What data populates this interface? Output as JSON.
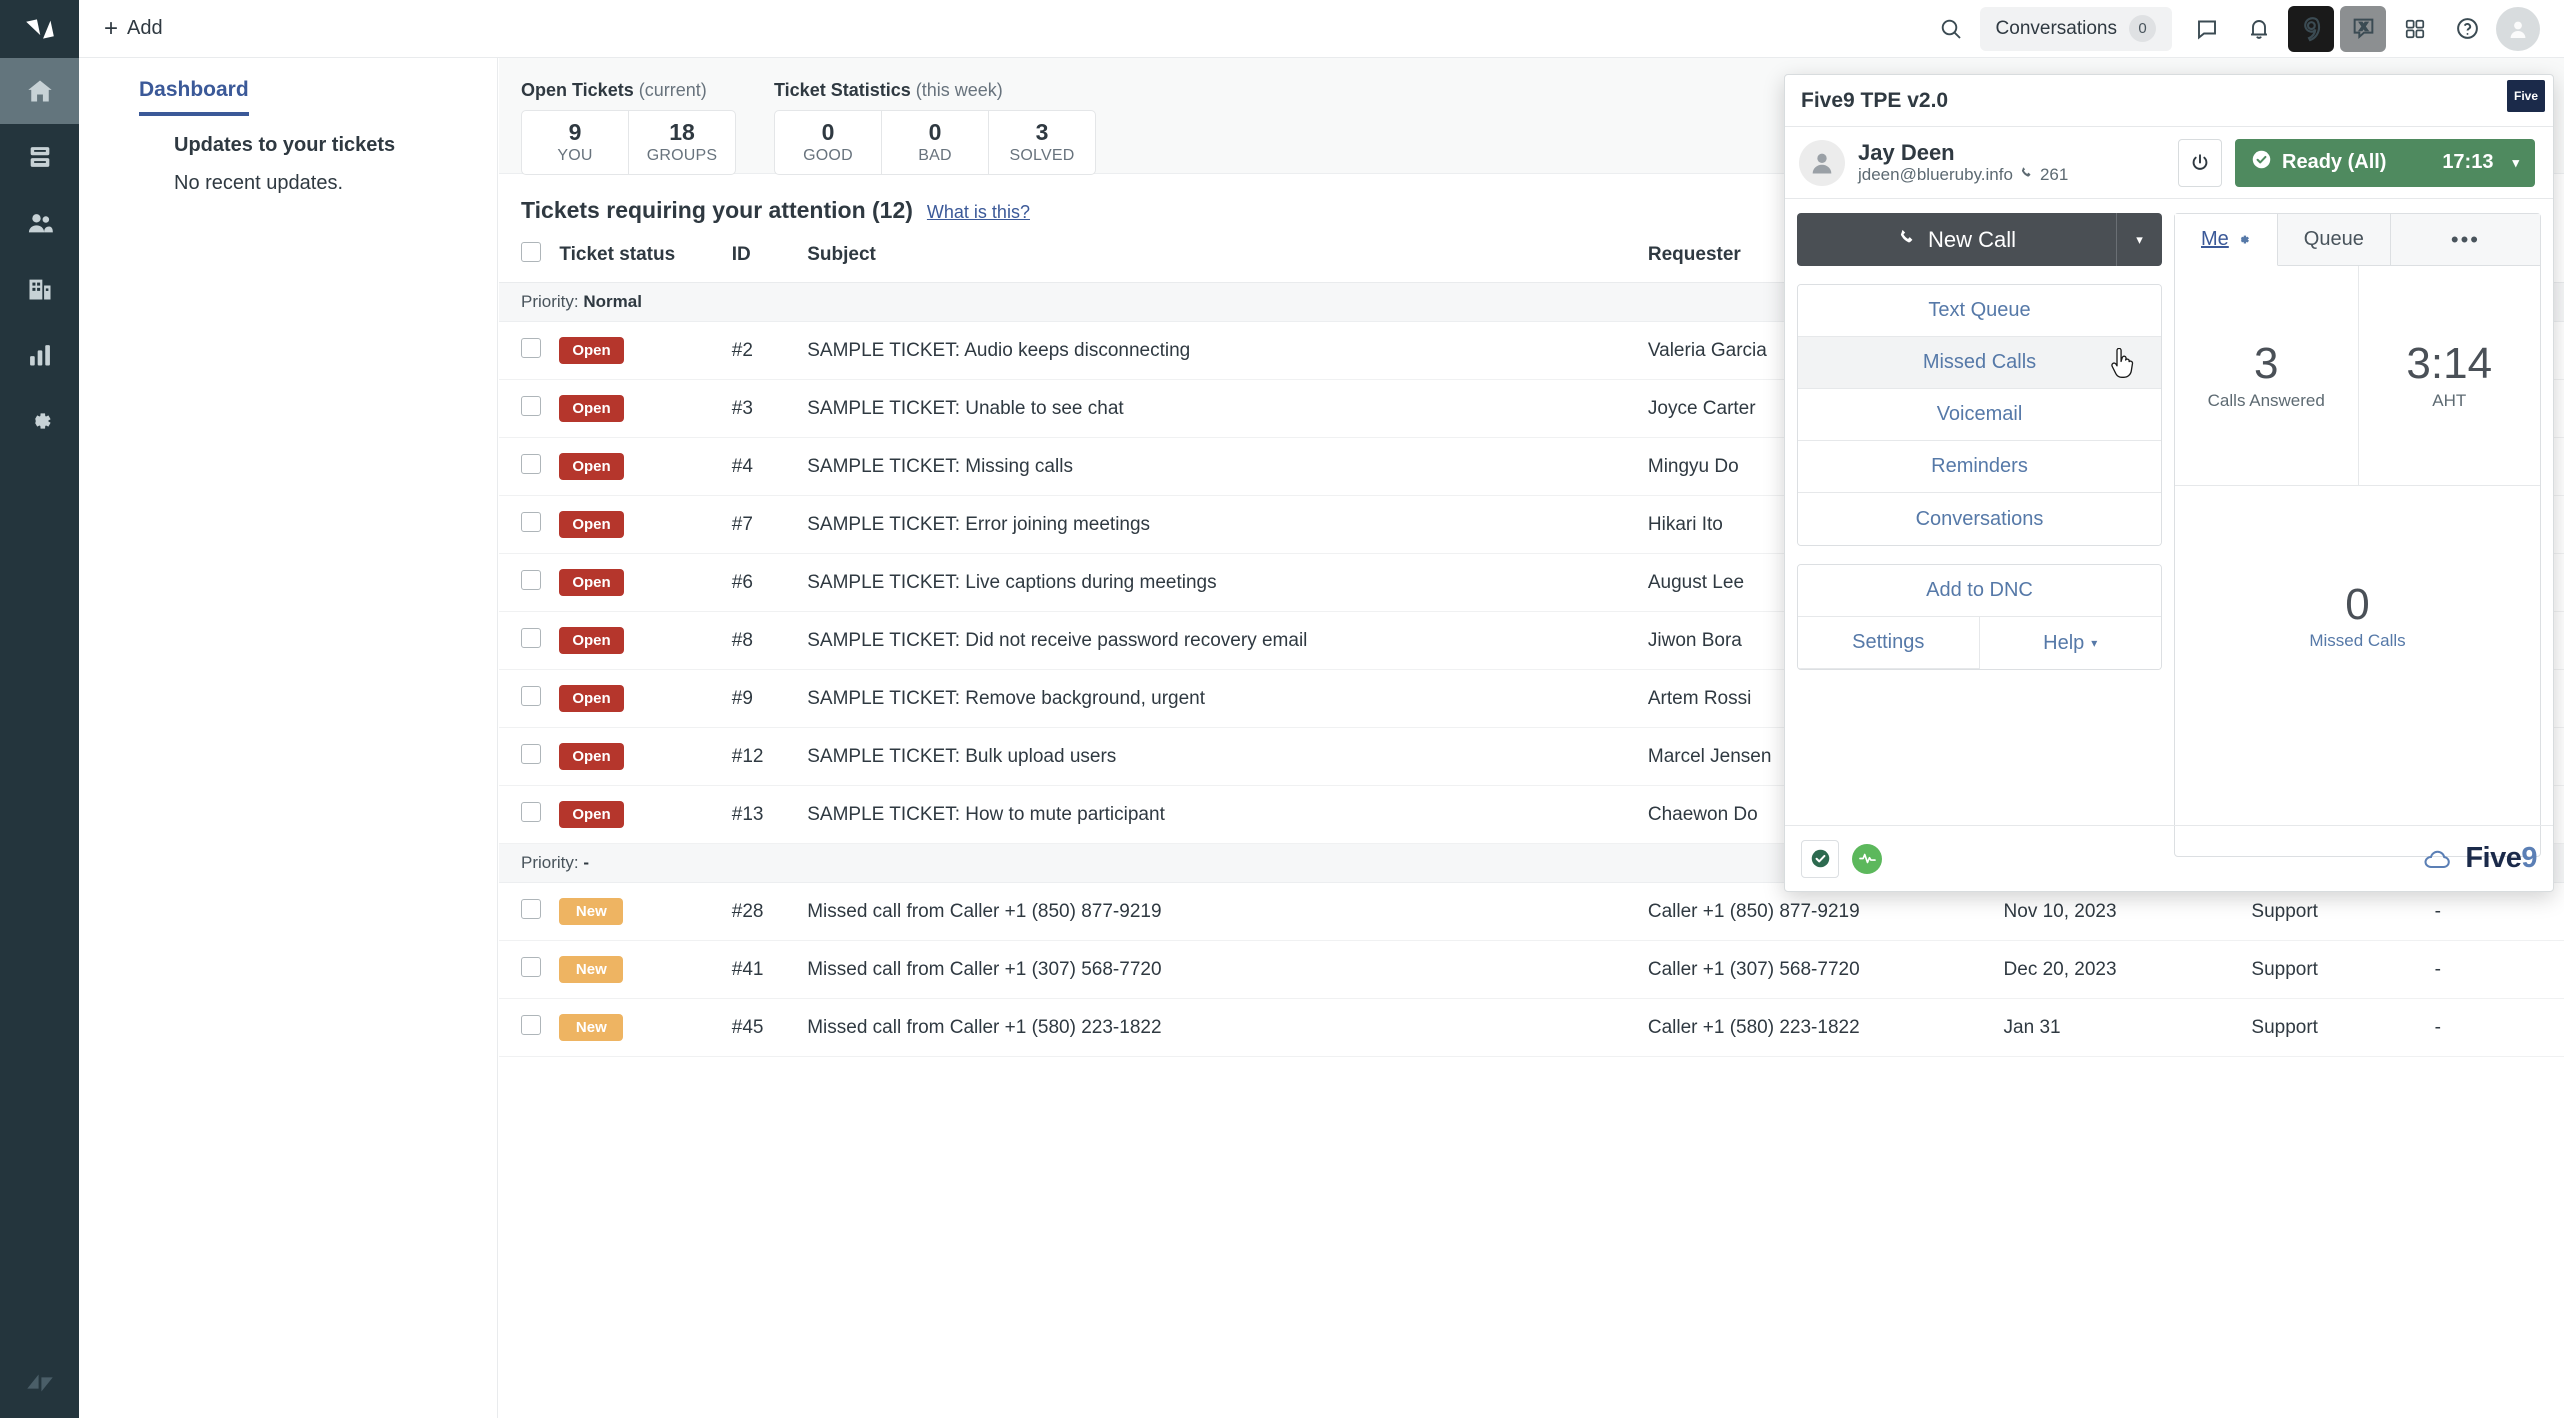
{
  "rail": {
    "items": [
      {
        "name": "zendesk-logo",
        "icon": "zendesk-logo-icon",
        "active": false
      },
      {
        "name": "home",
        "icon": "home-icon",
        "active": true
      },
      {
        "name": "views",
        "icon": "views-icon",
        "active": false
      },
      {
        "name": "customers",
        "icon": "people-icon",
        "active": false
      },
      {
        "name": "organizations",
        "icon": "building-icon",
        "active": false
      },
      {
        "name": "reporting",
        "icon": "bar-chart-icon",
        "active": false
      },
      {
        "name": "admin",
        "icon": "gear-icon",
        "active": false
      }
    ],
    "bottom_logo": "zendesk-mark-icon"
  },
  "topbar": {
    "add_label": "Add",
    "add_icon": "plus-icon",
    "search_icon": "search-icon",
    "conversations_label": "Conversations",
    "conversations_count": "0",
    "chat_icon": "chat-bubble-icon",
    "bell_icon": "bell-icon",
    "five9_icon_label": "9",
    "x_icon_label": "X",
    "apps_icon": "apps-grid-icon",
    "help_icon": "question-mark-icon",
    "avatar_icon": "user-avatar-icon"
  },
  "sidebar": {
    "tab_label": "Dashboard",
    "updates_title": "Updates to your tickets",
    "updates_empty": "No recent updates."
  },
  "stats": {
    "open_tickets": {
      "title_bold": "Open Tickets",
      "title_light": "(current)",
      "boxes": [
        {
          "num": "9",
          "label": "YOU"
        },
        {
          "num": "18",
          "label": "GROUPS"
        }
      ]
    },
    "ticket_statistics": {
      "title_bold": "Ticket Statistics",
      "title_light": "(this week)",
      "boxes": [
        {
          "num": "0",
          "label": "GOOD"
        },
        {
          "num": "0",
          "label": "BAD"
        },
        {
          "num": "3",
          "label": "SOLVED"
        }
      ]
    }
  },
  "attention": {
    "title": "Tickets requiring your attention (12)",
    "help_link": "What is this?"
  },
  "table": {
    "headers": {
      "status": "Ticket status",
      "id": "ID",
      "subject": "Subject",
      "requester": "Requester",
      "date": "",
      "group": "",
      "last": ""
    },
    "groups": [
      {
        "label_prefix": "Priority:",
        "label_value": "Normal",
        "rows": [
          {
            "status": "Open",
            "status_kind": "open",
            "id": "#2",
            "subject": "SAMPLE TICKET: Audio keeps disconnecting",
            "requester": "Valeria Garcia",
            "date": "",
            "group": "",
            "last": ""
          },
          {
            "status": "Open",
            "status_kind": "open",
            "id": "#3",
            "subject": "SAMPLE TICKET: Unable to see chat",
            "requester": "Joyce Carter",
            "date": "",
            "group": "",
            "last": ""
          },
          {
            "status": "Open",
            "status_kind": "open",
            "id": "#4",
            "subject": "SAMPLE TICKET: Missing calls",
            "requester": "Mingyu Do",
            "date": "",
            "group": "",
            "last": ""
          },
          {
            "status": "Open",
            "status_kind": "open",
            "id": "#7",
            "subject": "SAMPLE TICKET: Error joining meetings",
            "requester": "Hikari Ito",
            "date": "",
            "group": "",
            "last": ""
          },
          {
            "status": "Open",
            "status_kind": "open",
            "id": "#6",
            "subject": "SAMPLE TICKET: Live captions during meetings",
            "requester": "August Lee",
            "date": "",
            "group": "",
            "last": ""
          },
          {
            "status": "Open",
            "status_kind": "open",
            "id": "#8",
            "subject": "SAMPLE TICKET: Did not receive password recovery email",
            "requester": "Jiwon Bora",
            "date": "",
            "group": "",
            "last": ""
          },
          {
            "status": "Open",
            "status_kind": "open",
            "id": "#9",
            "subject": "SAMPLE TICKET: Remove background, urgent",
            "requester": "Artem Rossi",
            "date": "",
            "group": "",
            "last": ""
          },
          {
            "status": "Open",
            "status_kind": "open",
            "id": "#12",
            "subject": "SAMPLE TICKET: Bulk upload users",
            "requester": "Marcel Jensen",
            "date": "",
            "group": "",
            "last": ""
          },
          {
            "status": "Open",
            "status_kind": "open",
            "id": "#13",
            "subject": "SAMPLE TICKET: How to mute participant",
            "requester": "Chaewon Do",
            "date": "",
            "group": "",
            "last": ""
          }
        ]
      },
      {
        "label_prefix": "Priority:",
        "label_value": "-",
        "rows": [
          {
            "status": "New",
            "status_kind": "new",
            "id": "#28",
            "subject": "Missed call from Caller +1 (850) 877-9219",
            "requester": "Caller +1 (850) 877-9219",
            "date": "Nov 10, 2023",
            "group": "Support",
            "last": "-"
          },
          {
            "status": "New",
            "status_kind": "new",
            "id": "#41",
            "subject": "Missed call from Caller +1 (307) 568-7720",
            "requester": "Caller +1 (307) 568-7720",
            "date": "Dec 20, 2023",
            "group": "Support",
            "last": "-"
          },
          {
            "status": "New",
            "status_kind": "new",
            "id": "#45",
            "subject": "Missed call from Caller +1 (580) 223-1822",
            "requester": "Caller +1 (580) 223-1822",
            "date": "Jan 31",
            "group": "Support",
            "last": "-"
          }
        ]
      }
    ]
  },
  "five9": {
    "title": "Five9 TPE v2.0",
    "header_logo_text": "Five",
    "agent": {
      "name": "Jay Deen",
      "email": "jdeen@blueruby.info",
      "extension": "261",
      "phone_icon": "phone-icon",
      "avatar_icon": "user-avatar-icon"
    },
    "power_icon": "power-icon",
    "status": {
      "check_icon": "check-circle-icon",
      "label": "Ready (All)",
      "timer": "17:13",
      "caret": "▾",
      "color": "#4f8a5f"
    },
    "new_call": {
      "label": "New Call",
      "icon": "phone-icon",
      "caret": "▾"
    },
    "buttons_primary": [
      {
        "label": "Text Queue",
        "hovered": false
      },
      {
        "label": "Missed Calls",
        "hovered": true
      },
      {
        "label": "Voicemail",
        "hovered": false
      },
      {
        "label": "Reminders",
        "hovered": false
      },
      {
        "label": "Conversations",
        "hovered": false
      }
    ],
    "buttons_secondary": {
      "dnc": "Add to DNC",
      "settings": "Settings",
      "help": "Help",
      "help_caret": "▾"
    },
    "tabs": [
      {
        "label": "Me",
        "active": true,
        "gear_icon": "gear-icon"
      },
      {
        "label": "Queue",
        "active": false
      },
      {
        "label": "•••",
        "active": false,
        "name": "more"
      }
    ],
    "kpis": [
      {
        "value": "3",
        "label": "Calls Answered",
        "link": false
      },
      {
        "value": "3:14",
        "label": "AHT",
        "link": false
      },
      {
        "value": "0",
        "label": "Missed Calls",
        "link": true
      }
    ],
    "footer": {
      "check_icon": "check-circle-icon",
      "pulse_icon": "heartbeat-icon",
      "logo_text": "Five",
      "logo_digit": "9"
    }
  },
  "cursor": {
    "icon": "pointer-hand-cursor"
  }
}
